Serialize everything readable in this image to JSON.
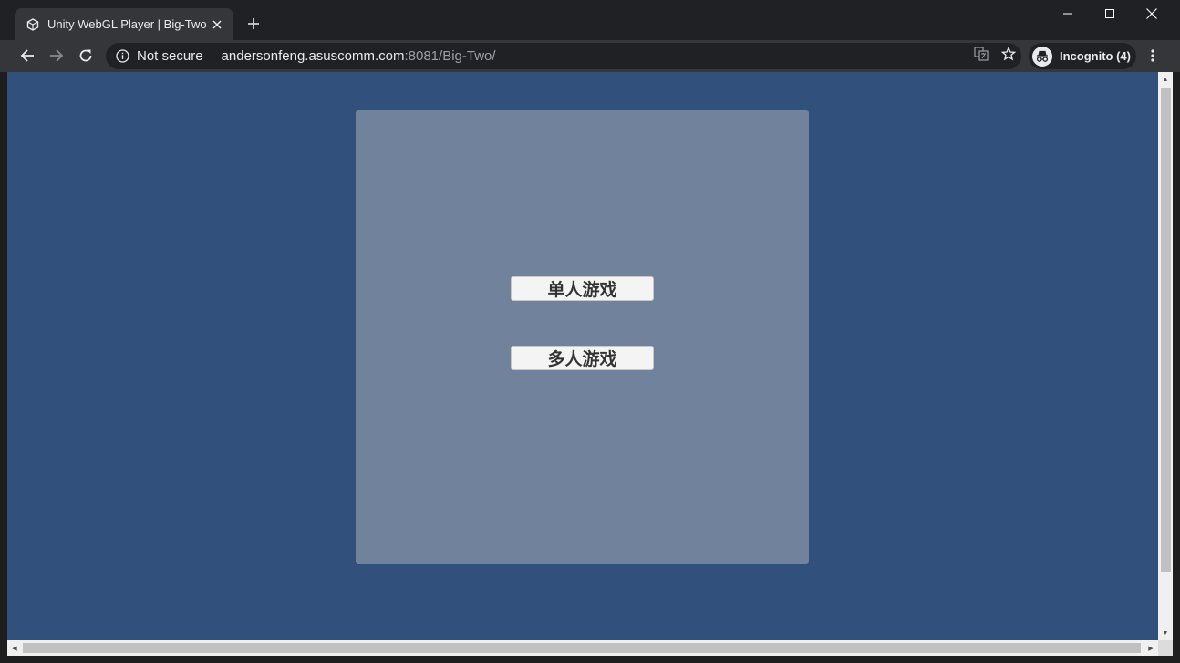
{
  "tab": {
    "title": "Unity WebGL Player | Big-Two",
    "favicon": "unity-icon",
    "close": "close-tab-icon"
  },
  "window_controls": [
    "minimize-icon",
    "maximize-icon",
    "close-window-icon"
  ],
  "toolbar": {
    "security_label": "Not secure",
    "url_host": "andersonfeng.asuscomm.com",
    "url_rest": ":8081/Big-Two/",
    "incognito_label": "Incognito (4)"
  },
  "game": {
    "single_player_label": "单人游戏",
    "multi_player_label": "多人游戏"
  },
  "colors": {
    "page_bg": "#31507c",
    "panel_bg": "#71829d",
    "button_bg": "#f4f4f4"
  }
}
